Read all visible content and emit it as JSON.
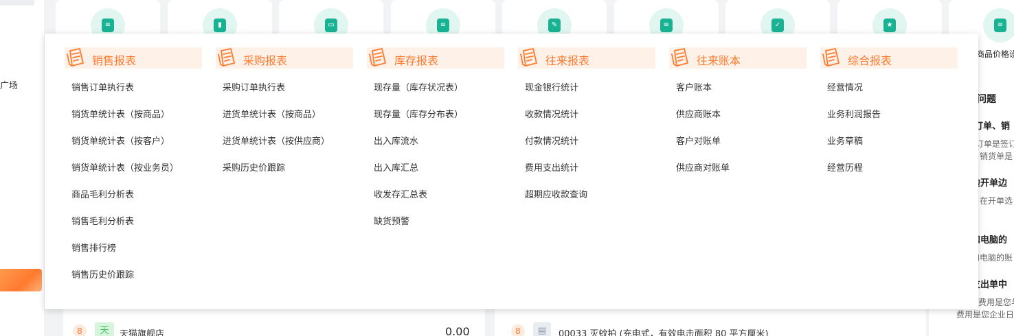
{
  "sidebar": {
    "nav_text": "广场"
  },
  "quick_cards": [
    {
      "icon": "sales-list-icon"
    },
    {
      "icon": "bar-chart-icon"
    },
    {
      "icon": "wallet-icon"
    },
    {
      "icon": "document-icon"
    },
    {
      "icon": "edit-document-icon"
    },
    {
      "icon": "invoice-icon"
    },
    {
      "icon": "checklist-icon"
    },
    {
      "icon": "star-book-icon"
    },
    {
      "icon": "price-doc-icon",
      "label": "商品价格设"
    }
  ],
  "menu": {
    "columns": [
      {
        "title": "销售报表",
        "items": [
          "销售订单执行表",
          "销货单统计表（按商品）",
          "销货单统计表（按客户）",
          "销货单统计表（按业务员）",
          "商品毛利分析表",
          "销售毛利分析表",
          "销售排行榜",
          "销售历史价跟踪"
        ]
      },
      {
        "title": "采购报表",
        "items": [
          "采购订单执行表",
          "进货单统计表（按商品）",
          "进货单统计表（按供应商）",
          "采购历史价跟踪"
        ]
      },
      {
        "title": "库存报表",
        "items": [
          "现存量（库存状况表）",
          "现存量（库存分布表）",
          "出入库流水",
          "出入库汇总",
          "收发存汇总表",
          "缺货预警"
        ]
      },
      {
        "title": "往来报表",
        "items": [
          "现金银行统计",
          "收款情况统计",
          "付款情况统计",
          "费用支出统计",
          "超期应收款查询"
        ]
      },
      {
        "title": "往来账本",
        "items": [
          "客户账本",
          "供应商账本",
          "客户对账单",
          "供应商对账单"
        ]
      },
      {
        "title": "综合报表",
        "items": [
          "经营情况",
          "业务利润报告",
          "业务草稿",
          "经营历程"
        ]
      }
    ]
  },
  "right_panel": {
    "heading": "问题",
    "entries": [
      {
        "title": "订单、销",
        "lines": [
          "订单是签订",
          "销货单是"
        ]
      },
      {
        "title": "边开单边",
        "lines": [
          "在开单选",
          "。"
        ]
      },
      {
        "title": "和电脑的",
        "lines": [
          "和电脑的账"
        ]
      },
      {
        "title": "支出单中",
        "lines": [
          "费用是您与",
          "费用是您企业日"
        ]
      }
    ]
  },
  "bottom_rows": {
    "left": {
      "rank": "8",
      "shop_icon": "天",
      "shop_name": "天猫旗舰店",
      "amount": "0.00"
    },
    "mid": {
      "rank": "8",
      "product": "00033 灭蚊拍 (充电式，有效电击面积 80 平方厘米)"
    }
  },
  "colors": {
    "accent": "#ff7a2e",
    "header_bg": "#fef1e8",
    "teal": "#19b394"
  }
}
